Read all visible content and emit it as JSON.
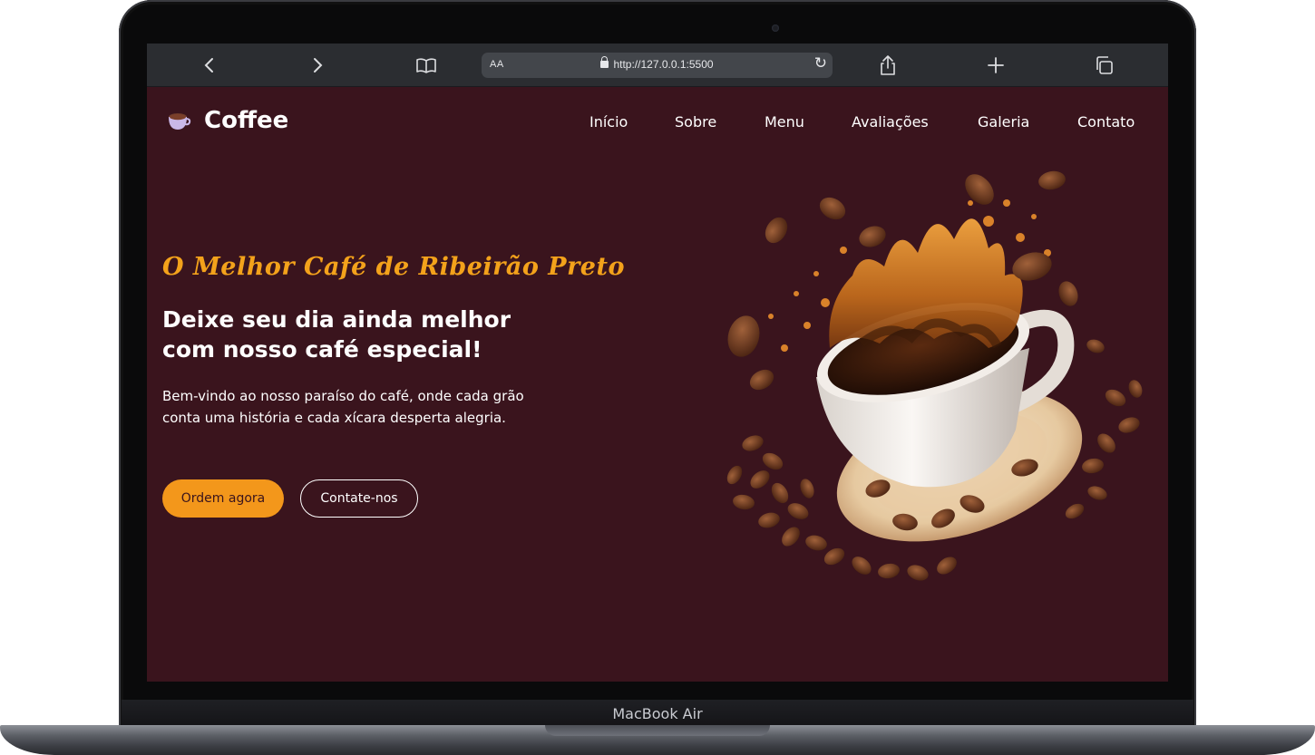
{
  "device": {
    "label": "MacBook Air"
  },
  "browser": {
    "back_icon": "chevron-left-icon",
    "forward_icon": "chevron-right-icon",
    "reader_icon": "book-icon",
    "aa_label": "AA",
    "url": "http://127.0.0.1:5500",
    "reload_icon": "reload-icon",
    "share_icon": "share-icon",
    "new_tab_icon": "plus-icon",
    "tabs_icon": "tabs-icon"
  },
  "header": {
    "brand": "Coffee",
    "logo_icon": "coffee-cup-icon",
    "nav": [
      "Início",
      "Sobre",
      "Menu",
      "Avaliações",
      "Galeria",
      "Contato"
    ]
  },
  "hero": {
    "tagline": "O Melhor Café de Ribeirão Preto",
    "headline_line1": "Deixe seu dia ainda melhor",
    "headline_line2": "com nosso café especial!",
    "description": "Bem-vindo ao nosso paraíso do café, onde cada grão conta uma história e cada xícara desperta alegria.",
    "primary_button": "Ordem agora",
    "secondary_button": "Contate-nos",
    "image_icon": "coffee-splash-illustration"
  },
  "colors": {
    "background": "#3a141d",
    "accent": "#f3971b",
    "text": "#ffffff",
    "browser_bar": "#2b2d31"
  }
}
